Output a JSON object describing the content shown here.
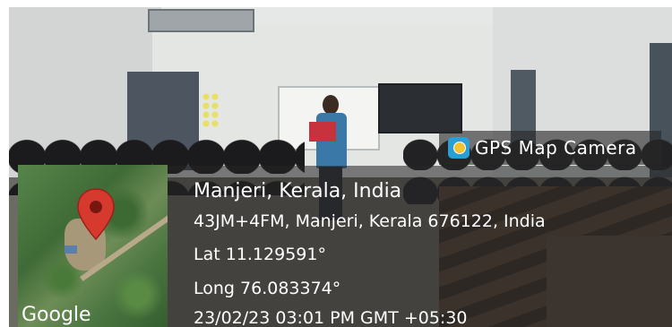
{
  "overlay": {
    "app_label": "GPS Map Camera",
    "app_icon": "gps-map-camera-icon",
    "map_credit": "Google",
    "location_title": "Manjeri, Kerala, India",
    "address": "43JM+4FM, Manjeri, Kerala 676122, India",
    "latitude": "Lat 11.129591°",
    "longitude": "Long 76.083374°",
    "datetime": "23/02/23 03:01 PM GMT +05:30"
  },
  "colors": {
    "pin": "#d63a2f",
    "overlay": "#262626",
    "text": "#ffffff"
  }
}
